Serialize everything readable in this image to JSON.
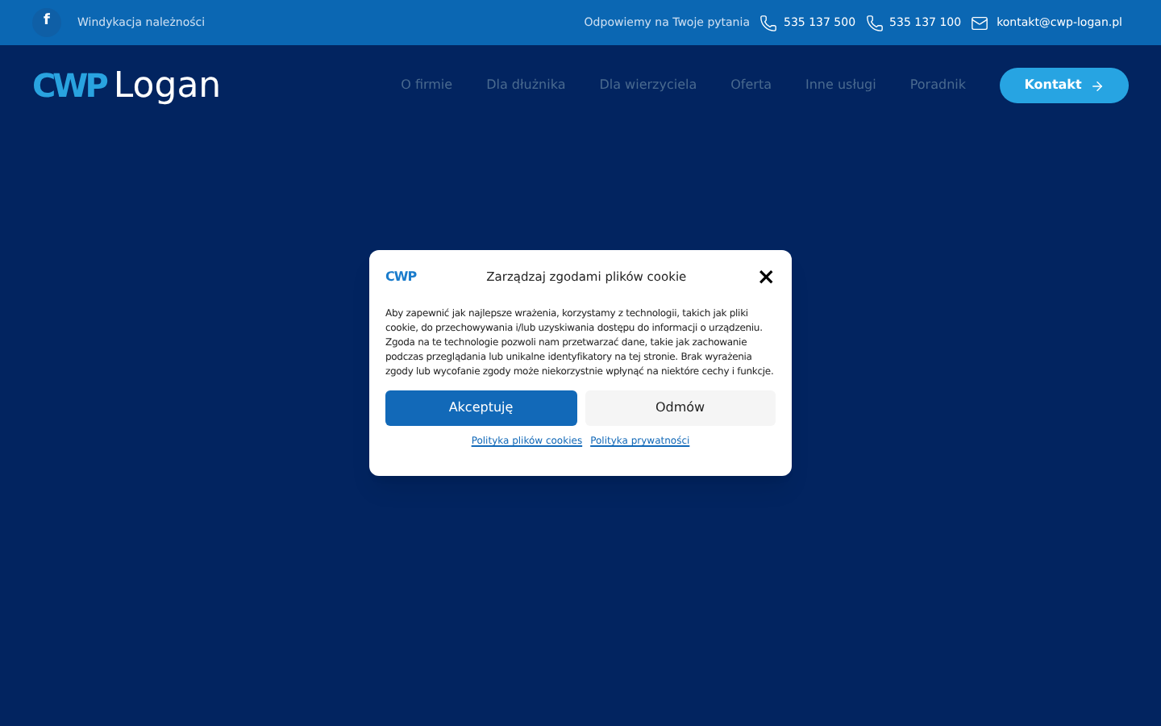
{
  "topbar": {
    "social": "f",
    "tagline": "Windykacja należności",
    "contact_label": "Odpowiemy na Twoje pytania",
    "phones": [
      "535 137 500",
      "535 137 100"
    ],
    "email": "kontakt@cwp-logan.pl"
  },
  "header": {
    "logo": {
      "mark": "CWP",
      "name": "Logan"
    },
    "nav": [
      "O firmie",
      "Dla dłużnika",
      "Dla wierzyciela",
      "Oferta",
      "Inne usługi",
      "Poradnik"
    ],
    "cta": "Kontakt"
  },
  "cookie_dialog": {
    "logo": "CWP",
    "title": "Zarządzaj zgodami plików cookie",
    "close": "×",
    "body": "Aby zapewnić jak najlepsze wrażenia, korzystamy z technologii, takich jak pliki cookie, do przechowywania i/lub uzyskiwania dostępu do informacji o urządzeniu. Zgoda na te technologie pozwoli nam przetwarzać dane, takie jak zachowanie podczas przeglądania lub unikalne identyfikatory na tej stronie. Brak wyrażenia zgody lub wycofanie zgody może niekorzystnie wpłynąć na niektóre cechy i funkcje.",
    "accept": "Akceptuję",
    "deny": "Odmów",
    "links": [
      "Polityka plików cookies",
      "Polityka prywatności"
    ]
  }
}
